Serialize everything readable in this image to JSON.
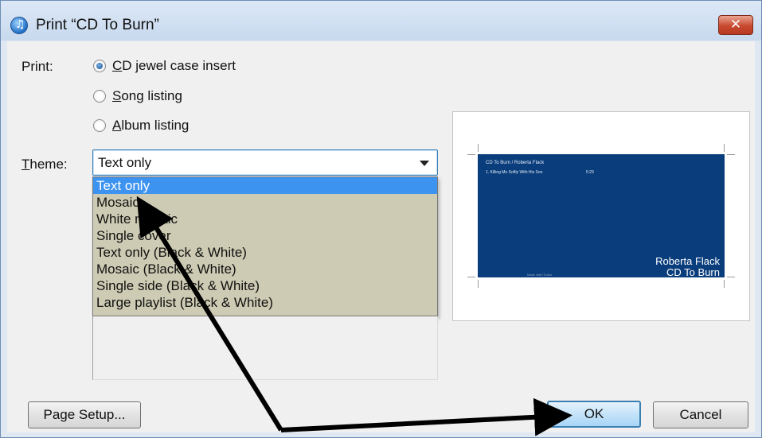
{
  "window": {
    "title": "Print “CD To Burn”",
    "app_icon": "itunes-icon",
    "close_icon": "close-icon",
    "close_glyph": "✕"
  },
  "print_section": {
    "label": "Print:",
    "options": [
      {
        "label_first": "C",
        "label_rest": "D jewel case insert",
        "checked": true
      },
      {
        "label_first": "S",
        "label_rest": "ong listing",
        "checked": false
      },
      {
        "label_first": "A",
        "label_rest": "lbum listing",
        "checked": false
      }
    ]
  },
  "theme": {
    "label_first": "T",
    "label_rest": "heme:",
    "selected": "Text only",
    "options": [
      "Text only",
      "Mosaic",
      "White mosaic",
      "Single cover",
      "Text only (Black & White)",
      "Mosaic (Black & White)",
      "Single side (Black & White)",
      "Large playlist (Black & White)"
    ],
    "highlighted_index": 0
  },
  "preview": {
    "header": "CD To Burn / Roberta Flack",
    "track": "1. Killing Me Softly With His Son",
    "time": "5:29",
    "artist": "Roberta Flack",
    "album": "CD To Burn",
    "footer": "Made with iTunes",
    "colors": {
      "insert_bg": "#0a3d7c"
    }
  },
  "buttons": {
    "page_setup": "Page Setup...",
    "ok": "OK",
    "cancel": "Cancel"
  },
  "annotation": {
    "arrow_color": "#000000"
  }
}
